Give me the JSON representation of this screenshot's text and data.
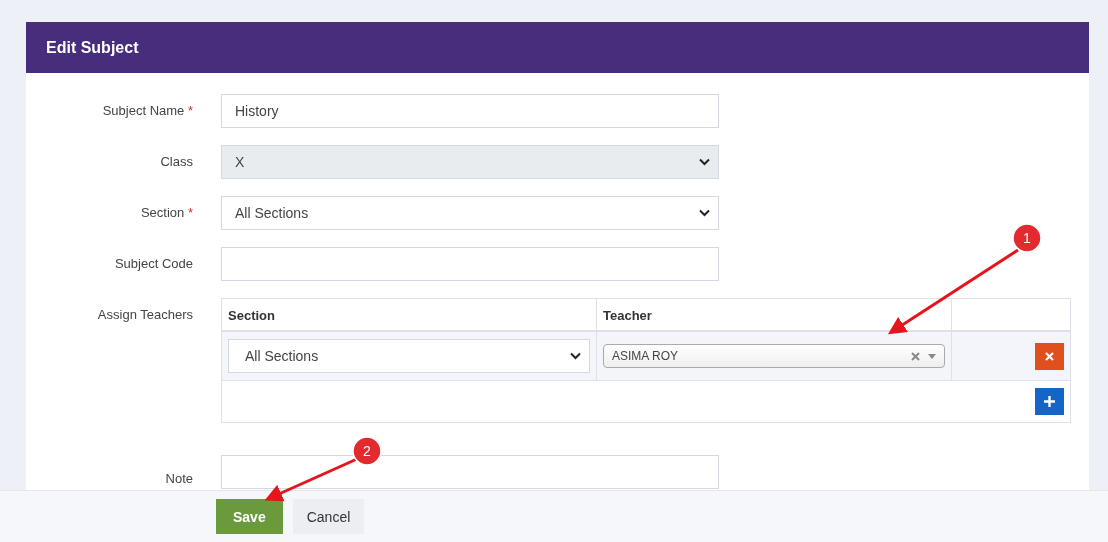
{
  "card": {
    "title": "Edit Subject"
  },
  "fields": [
    {
      "kind": "text",
      "label": "Subject Name",
      "required_mark": "*",
      "value": "History",
      "disabled": false
    },
    {
      "kind": "select",
      "label": "Class",
      "value": "X",
      "disabled": true
    },
    {
      "kind": "select",
      "label": "Section",
      "required_mark": "*",
      "value": "All Sections",
      "disabled": false
    },
    {
      "kind": "text",
      "label": "Subject Code",
      "disabled": false
    }
  ],
  "assign_teachers": {
    "label": "Assign Teachers",
    "columns": [
      "Section",
      "Teacher"
    ],
    "rows": [
      {
        "section": "All Sections",
        "teacher": "ASIMA ROY"
      }
    ]
  },
  "note": {
    "label": "Note"
  },
  "buttons": [
    {
      "kind": "primary",
      "label": "Save"
    },
    {
      "kind": "secondary",
      "label": "Cancel"
    }
  ],
  "annotations": [
    {
      "number": "1"
    },
    {
      "number": "2"
    }
  ]
}
